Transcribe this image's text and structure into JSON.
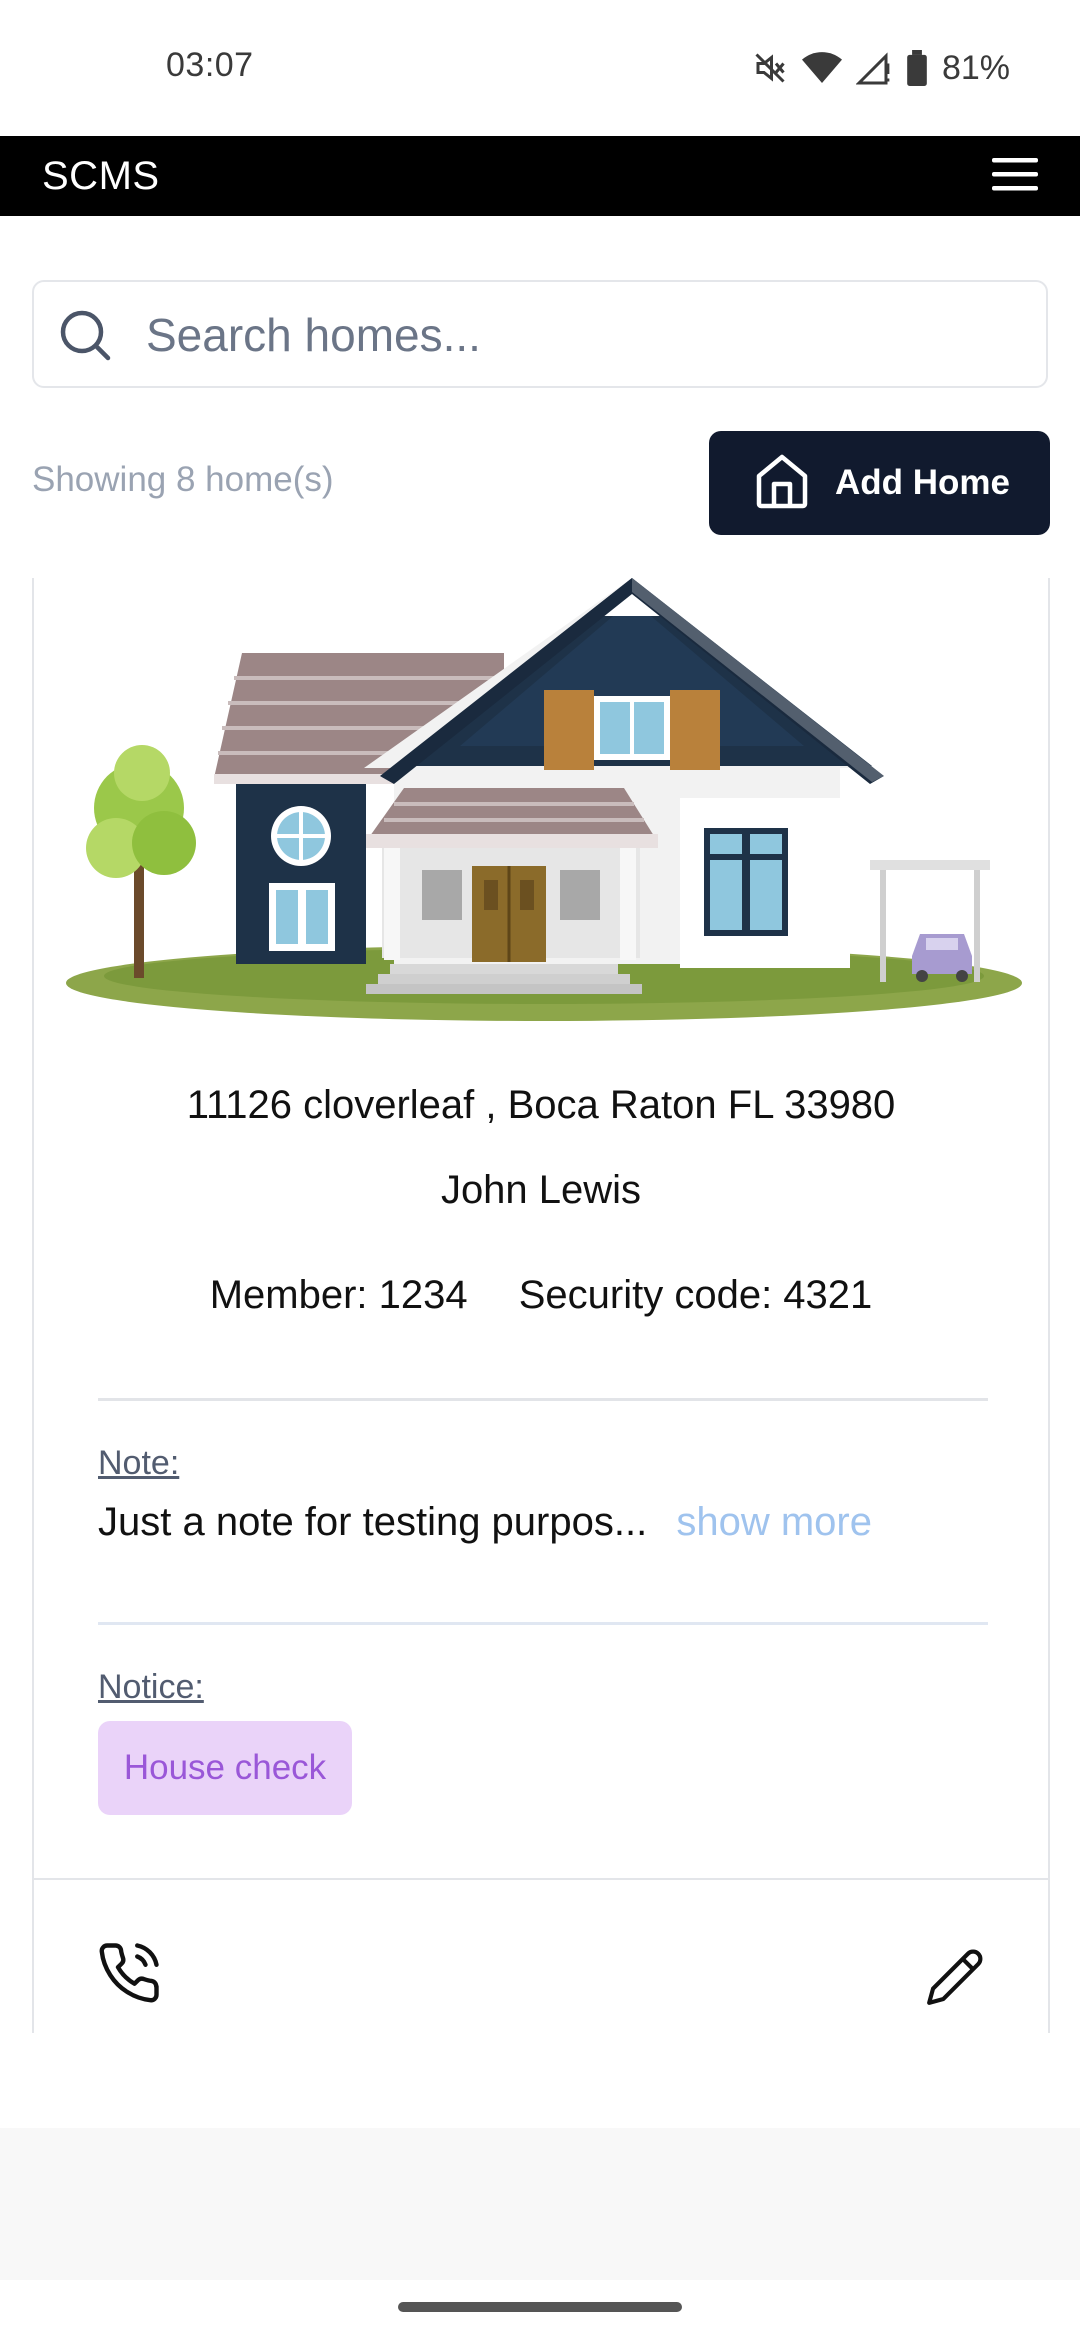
{
  "status_bar": {
    "time": "03:07",
    "battery_percent": "81%",
    "icons": [
      "mute-icon",
      "wifi-icon",
      "signal-icon",
      "battery-icon"
    ]
  },
  "app_bar": {
    "title": "SCMS",
    "menu_icon": "hamburger-menu-icon"
  },
  "search": {
    "placeholder": "Search homes...",
    "value": ""
  },
  "list": {
    "count_text": "Showing 8 home(s)",
    "add_button_label": "Add Home"
  },
  "home_card": {
    "image": "house-illustration",
    "address": "11126 cloverleaf , Boca Raton FL 33980",
    "owner": "John Lewis",
    "member": "Member: 1234",
    "security_code": "Security code: 4321",
    "note_label": "Note:",
    "note_text": "Just a note for testing purpos...",
    "show_more": "show more",
    "notice_label": "Notice:",
    "notice_badge": "House check",
    "actions": [
      "phone-icon",
      "edit-pencil-icon"
    ]
  },
  "colors": {
    "app_bar": "#000000",
    "add_button": "#111a2e",
    "notice_badge_bg": "#ead3f9",
    "notice_badge_text": "#9a57d8",
    "show_more": "#9fc3ee"
  }
}
